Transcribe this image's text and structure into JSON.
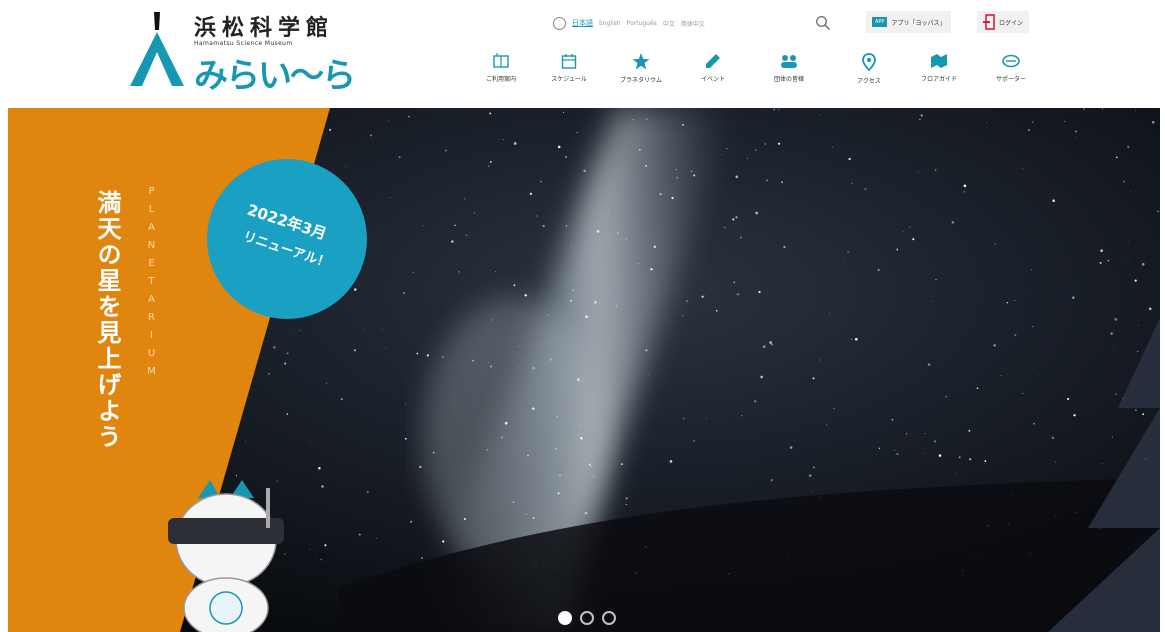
{
  "header": {
    "logo": {
      "jp_name": "浜松科学館",
      "en_name": "Hamamatsu Science Museum",
      "brand": "みらい〜ら"
    },
    "languages": [
      {
        "label": "日本語",
        "active": true
      },
      {
        "label": "English",
        "active": false
      },
      {
        "label": "Português",
        "active": false
      },
      {
        "label": "中文",
        "active": false
      },
      {
        "label": "简体中文",
        "active": false
      }
    ],
    "app_button": {
      "tag": "APP",
      "label": "アプリ「ヨッパス」"
    },
    "login_button": {
      "label": "ログイン"
    },
    "nav": [
      {
        "label": "ご利用案内",
        "icon": "guide-icon"
      },
      {
        "label": "スケジュール",
        "icon": "calendar-icon"
      },
      {
        "label": "プラネタリウム",
        "icon": "star-icon"
      },
      {
        "label": "イベント",
        "icon": "pencil-icon"
      },
      {
        "label": "団体の皆様",
        "icon": "group-icon"
      },
      {
        "label": "アクセス",
        "icon": "map-pin-icon"
      },
      {
        "label": "フロアガイド",
        "icon": "floor-guide-icon"
      },
      {
        "label": "サポーター",
        "icon": "supporter-icon"
      }
    ]
  },
  "hero": {
    "title": "満天の星を見上げよう",
    "subtitle": "PLANETARIUM",
    "badge_line1": "2022年3月",
    "badge_line2": "リニューアル！",
    "slides": 3,
    "active_slide": 1
  },
  "colors": {
    "accent": "#1698b2",
    "orange": "#e0850e",
    "badge": "#1aa0c3"
  }
}
